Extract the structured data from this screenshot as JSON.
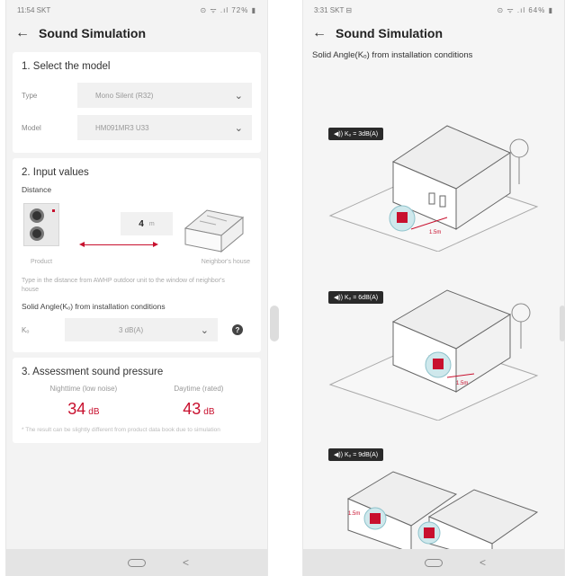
{
  "left": {
    "status": {
      "time": "11:54 SKT",
      "icons": "⊙ ᯤ .ıl 72% ▮"
    },
    "header": {
      "back_icon": "←",
      "title": "Sound Simulation"
    },
    "model_card": {
      "title": "1. Select the model",
      "type": {
        "label": "Type",
        "value": "Mono Silent (R32)"
      },
      "model": {
        "label": "Model",
        "value": "HM091MR3 U33"
      }
    },
    "input_card": {
      "title": "2. Input values",
      "distance_label": "Distance",
      "distance_value": "4",
      "distance_unit": "m",
      "product_caption": "Product",
      "neighbor_caption": "Neighbor's house",
      "help_text": "Type in the distance from AWHP outdoor unit to the window of neighbor's house",
      "solid_angle_title": "Solid Angle(Kₒ) from installation conditions",
      "k_label": "Kₒ",
      "k_value": "3 dB(A)",
      "help_icon": "?"
    },
    "assessment": {
      "title": "3. Assessment sound pressure",
      "night_label": "Nighttime (low noise)",
      "night_value": "34",
      "day_label": "Daytime (rated)",
      "day_value": "43",
      "unit": "dB",
      "note": "* The result can be slightly different from product data book due to simulation"
    }
  },
  "right": {
    "status": {
      "time": "3:31 SKT ⊟",
      "icons": "⊙ ᯤ .ıl 64% ▮"
    },
    "header": {
      "back_icon": "←",
      "title": "Sound Simulation"
    },
    "section_title": "Solid Angle(Kₒ) from installation conditions",
    "scenes": [
      {
        "badge": "◀)) Kₒ = 3dB(A)",
        "distance": "1.5m"
      },
      {
        "badge": "◀)) Kₒ = 6dB(A)",
        "distance": "1.5m"
      },
      {
        "badge": "◀)) Kₒ = 9dB(A)",
        "distance": "1.5m"
      }
    ]
  },
  "nav": {
    "back_glyph": "<"
  },
  "colors": {
    "accent": "#c8102e",
    "card": "#ffffff",
    "background": "#f3f3f3"
  }
}
